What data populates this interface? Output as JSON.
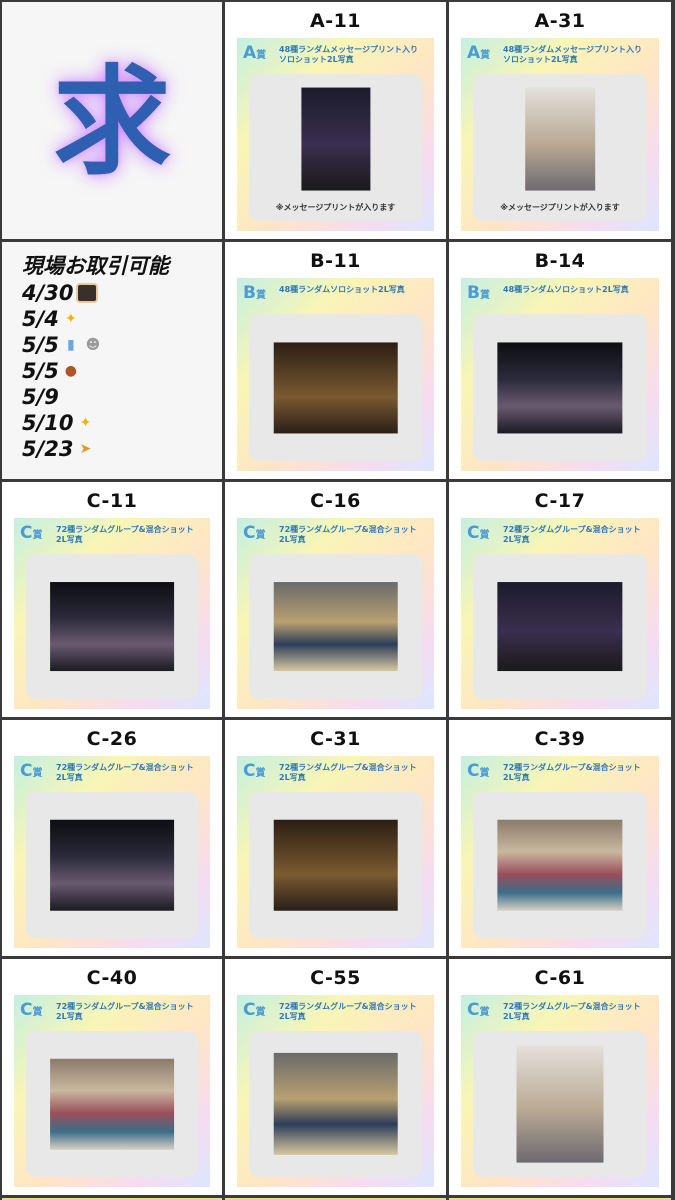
{
  "want_panel": {
    "char": "求"
  },
  "info_panel": {
    "title": "現場お取引可能",
    "dates": [
      {
        "date": "4/30",
        "icon": "bento-box-icon"
      },
      {
        "date": "5/4",
        "icon": "star-icon"
      },
      {
        "date": "5/5",
        "icon": "baby-bottle-icon",
        "icon2": "ghost-icon"
      },
      {
        "date": "5/5",
        "icon": "meat-icon"
      },
      {
        "date": "5/9",
        "icon": ""
      },
      {
        "date": "5/10",
        "icon": "star-icon"
      },
      {
        "date": "5/23",
        "icon": "runner-icon"
      }
    ]
  },
  "prize_text": {
    "A": {
      "badge": "A",
      "suffix": "賞",
      "desc": "48種ランダムメッセージプリント入り\nソロショット2L写真",
      "note": "※メッセージプリントが入ります"
    },
    "B": {
      "badge": "B",
      "suffix": "賞",
      "desc": "48種ランダムソロショット2L写真"
    },
    "C": {
      "badge": "C",
      "suffix": "賞",
      "desc": "72種ランダムグループ&混合ショット\n2L写真"
    }
  },
  "items": [
    {
      "code": "A-11"
    },
    {
      "code": "A-31"
    },
    {
      "code": "B-11"
    },
    {
      "code": "B-14"
    },
    {
      "code": "C-11"
    },
    {
      "code": "C-16"
    },
    {
      "code": "C-17"
    },
    {
      "code": "C-26"
    },
    {
      "code": "C-31"
    },
    {
      "code": "C-39"
    },
    {
      "code": "C-40"
    },
    {
      "code": "C-55"
    },
    {
      "code": "C-61"
    }
  ],
  "colors": {
    "want_char": "#2f5fb0",
    "glow": "#c77dff",
    "badge": "#4a9bd6"
  }
}
